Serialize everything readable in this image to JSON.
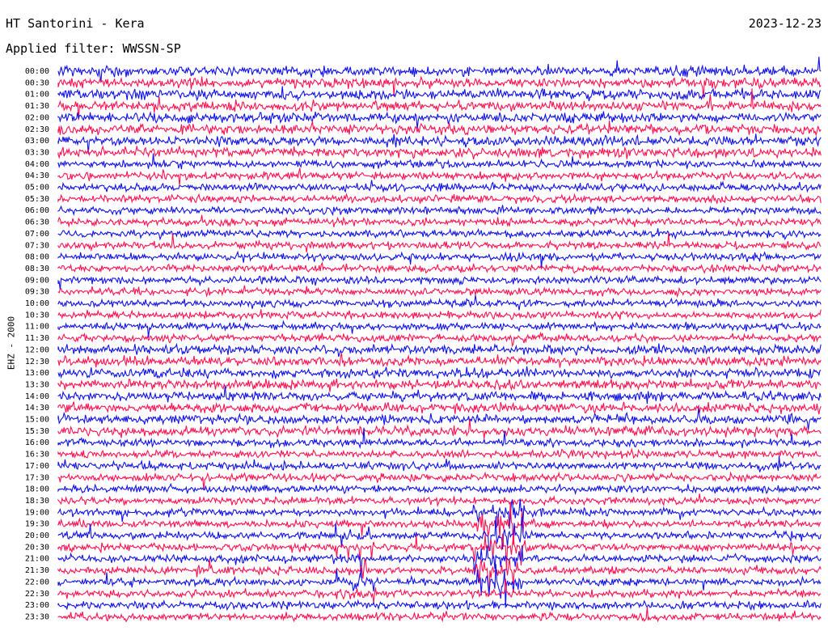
{
  "header": {
    "station": "HT Santorini - Kera",
    "date": "2023-12-23",
    "filter": "Applied filter: WWSSN-SP"
  },
  "channel_label": "EHZ - 2000",
  "colors": {
    "trace_a": "#1010e8",
    "trace_b": "#ff1050",
    "text": "#000000",
    "background": "#ffffff"
  },
  "chart_data": {
    "type": "line",
    "subtype": "helicorder",
    "y_tick_labels": [
      "00:00",
      "00:30",
      "01:00",
      "01:30",
      "02:00",
      "02:30",
      "03:00",
      "03:30",
      "04:00",
      "04:30",
      "05:00",
      "05:30",
      "06:00",
      "06:30",
      "07:00",
      "07:30",
      "08:00",
      "08:30",
      "09:00",
      "09:30",
      "10:00",
      "10:30",
      "11:00",
      "11:30",
      "12:00",
      "12:30",
      "13:00",
      "13:30",
      "14:00",
      "14:30",
      "15:00",
      "15:30",
      "16:00",
      "16:30",
      "17:00",
      "17:30",
      "18:00",
      "18:30",
      "19:00",
      "19:30",
      "20:00",
      "20:30",
      "21:00",
      "21:30",
      "22:00",
      "22:30",
      "23:00",
      "23:30"
    ],
    "trace_colors_alternating": [
      "blue",
      "red"
    ],
    "minutes_per_line": 30,
    "grid": false
  }
}
